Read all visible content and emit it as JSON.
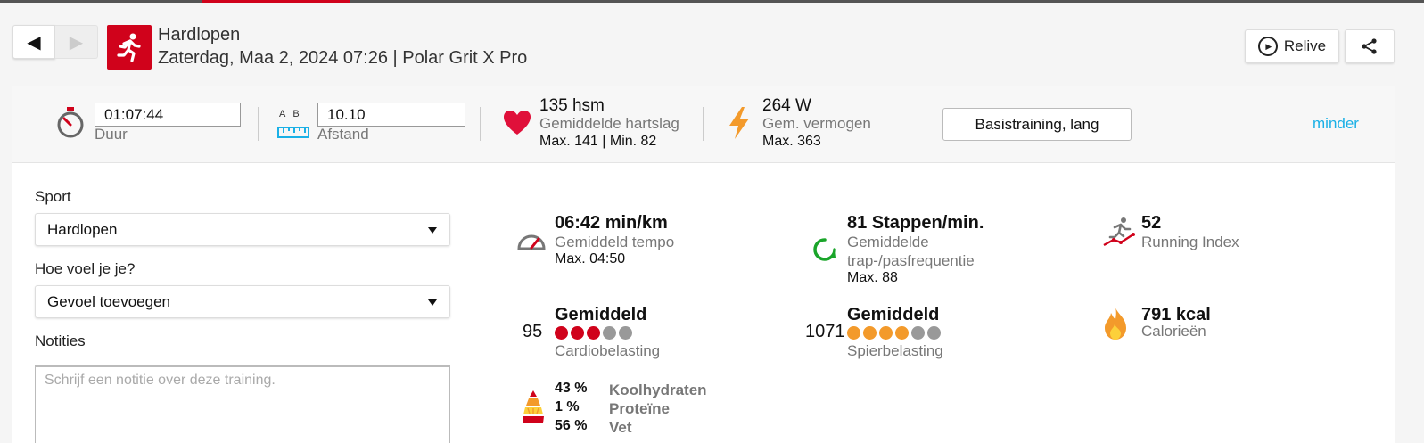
{
  "header": {
    "title": "Hardlopen",
    "subtitle": "Zaterdag, Maa 2, 2024 07:26 | Polar Grit X Pro",
    "relive_label": "Relive",
    "prev_glyph": "◀",
    "next_glyph": "▶"
  },
  "summary": {
    "duration_value": "01:07:44",
    "duration_label": "Duur",
    "distance_ab": "AB",
    "distance_value": "10.10",
    "distance_label": "Afstand",
    "hr_value": "135 hsm",
    "hr_label": "Gemiddelde hartslag",
    "hr_range": "Max. 141  |  Min. 82",
    "power_value": "264 W",
    "power_label": "Gem. vermogen",
    "power_max": "Max. 363",
    "training_type": "Basistraining, lang",
    "toggle_label": "minder"
  },
  "form": {
    "sport_label": "Sport",
    "sport_value": "Hardlopen",
    "feeling_label": "Hoe voel je je?",
    "feeling_value": "Gevoel toevoegen",
    "notes_label": "Notities",
    "notes_placeholder": "Schrijf een notitie over deze training."
  },
  "stats": {
    "pace": {
      "value": "06:42 min/km",
      "label": "Gemiddeld tempo",
      "max": "Max. 04:50"
    },
    "cadence": {
      "value": "81 Stappen/min.",
      "label_1": "Gemiddelde",
      "label_2": "trap-/pasfrequentie",
      "max": "Max. 88"
    },
    "running_index": {
      "value": "52",
      "label": "Running Index"
    },
    "cardio": {
      "number": "95",
      "level": "Gemiddeld",
      "label": "Cardiobelasting",
      "filled": 3,
      "total": 5,
      "color": "#d0021b"
    },
    "muscle": {
      "number": "1071",
      "level": "Gemiddeld",
      "label": "Spierbelasting",
      "filled": 4,
      "total": 6,
      "color": "#f39a2b"
    },
    "calories": {
      "value": "791 kcal",
      "label": "Calorieën"
    },
    "fuel": {
      "carbs_pct": "43 %",
      "carbs_label": "Koolhydraten",
      "protein_pct": "1 %",
      "protein_label": "Proteïne",
      "fat_pct": "56 %",
      "fat_label": "Vet"
    }
  },
  "colors": {
    "brand_red": "#d0021b",
    "link_blue": "#1ab0e6",
    "dot_empty": "#999999"
  }
}
